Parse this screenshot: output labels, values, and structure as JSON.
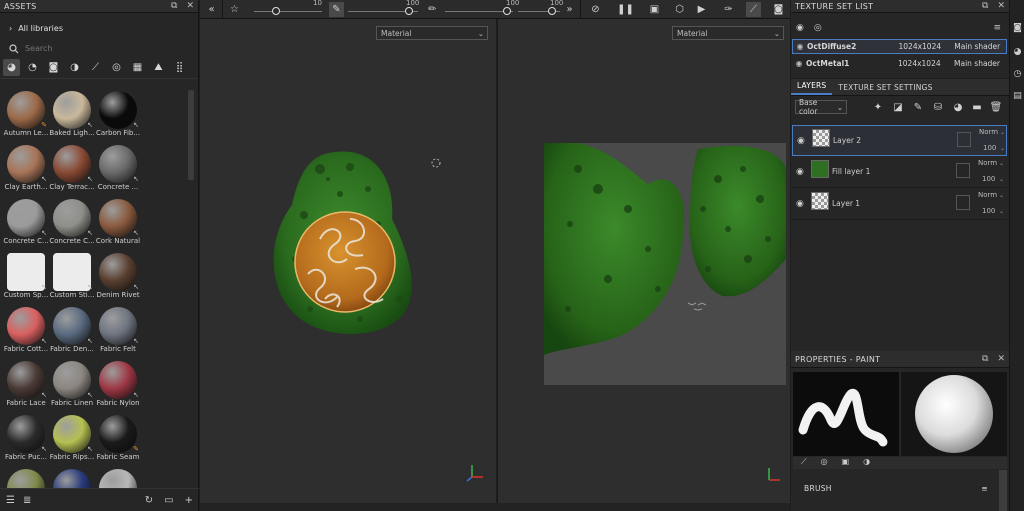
{
  "assets": {
    "title": "ASSETS",
    "library": "All libraries",
    "search_placeholder": "Search",
    "materials": [
      {
        "label": "Autumn Le...",
        "color": "#9c6a48",
        "badge": "orange"
      },
      {
        "label": "Baked Ligh...",
        "color": "#c9b89b",
        "badge": "plain"
      },
      {
        "label": "Carbon Fib...",
        "color": "#0a0a0a",
        "badge": "plain"
      },
      {
        "label": "Clay Earth...",
        "color": "#a87458",
        "badge": "plain"
      },
      {
        "label": "Clay Terrac...",
        "color": "#8a4a35",
        "badge": "plain"
      },
      {
        "label": "Concrete ...",
        "color": "#6a6a6a",
        "badge": "plain"
      },
      {
        "label": "Concrete C...",
        "color": "#9b9b9b",
        "badge": "plain"
      },
      {
        "label": "Concrete C...",
        "color": "#8e8e8a",
        "badge": "plain"
      },
      {
        "label": "Cork Natural",
        "color": "#8a5a3e",
        "badge": "plain"
      },
      {
        "label": "Custom Sp...",
        "color": "#ffffff",
        "badge": "plain"
      },
      {
        "label": "Custom Sti...",
        "color": "#ffffff",
        "badge": "plain"
      },
      {
        "label": "Denim Rivet",
        "color": "#5a4030",
        "badge": "plain"
      },
      {
        "label": "Fabric Cott...",
        "color": "#d96060",
        "badge": "plain"
      },
      {
        "label": "Fabric Den...",
        "color": "#5a6a80",
        "badge": "plain"
      },
      {
        "label": "Fabric Felt",
        "color": "#6e7480",
        "badge": "plain"
      },
      {
        "label": "Fabric Lace",
        "color": "#4a3a35",
        "badge": "plain"
      },
      {
        "label": "Fabric Linen",
        "color": "#8c8680",
        "badge": "plain"
      },
      {
        "label": "Fabric Nylon",
        "color": "#9e3845",
        "badge": "plain"
      },
      {
        "label": "Fabric Puc...",
        "color": "#2a2a2a",
        "badge": "plain"
      },
      {
        "label": "Fabric Rips...",
        "color": "#b6c052",
        "badge": "plain"
      },
      {
        "label": "Fabric Seam",
        "color": "#1a1a1a",
        "badge": "orange"
      },
      {
        "label": "",
        "color": "#7e8a4a",
        "badge": "none"
      },
      {
        "label": "",
        "color": "#283a7a",
        "badge": "none"
      },
      {
        "label": "",
        "color": "#b8b8b8",
        "badge": "none"
      }
    ]
  },
  "toolbar": {
    "val1": "10",
    "val2": "100",
    "val3": "100",
    "val4": "100"
  },
  "viewport3d": {
    "dropdown": "Material"
  },
  "viewport2d": {
    "dropdown": "Material"
  },
  "texture_set_list": {
    "title": "TEXTURE SET LIST",
    "sets": [
      {
        "name": "OctDiffuse2",
        "resolution": "1024x1024",
        "shader": "Main shader",
        "selected": true
      },
      {
        "name": "OctMetal1",
        "resolution": "1024x1024",
        "shader": "Main shader",
        "selected": false
      }
    ]
  },
  "layers_panel": {
    "tab_layers": "LAYERS",
    "tab_settings": "TEXTURE SET SETTINGS",
    "channel": "Base color",
    "layers": [
      {
        "name": "Layer 2",
        "blend": "Norm",
        "opacity": "100",
        "thumb": "checker",
        "selected": true
      },
      {
        "name": "Fill layer 1",
        "blend": "Norm",
        "opacity": "100",
        "thumb": "green",
        "selected": false
      },
      {
        "name": "Layer 1",
        "blend": "Norm",
        "opacity": "100",
        "thumb": "checker",
        "selected": false
      }
    ]
  },
  "properties": {
    "title": "PROPERTIES - PAINT",
    "section": "BRUSH"
  },
  "colors": {
    "accent": "#4a7cc3",
    "leaf_green": "#2f6f22",
    "orange": "#e78a2a"
  }
}
